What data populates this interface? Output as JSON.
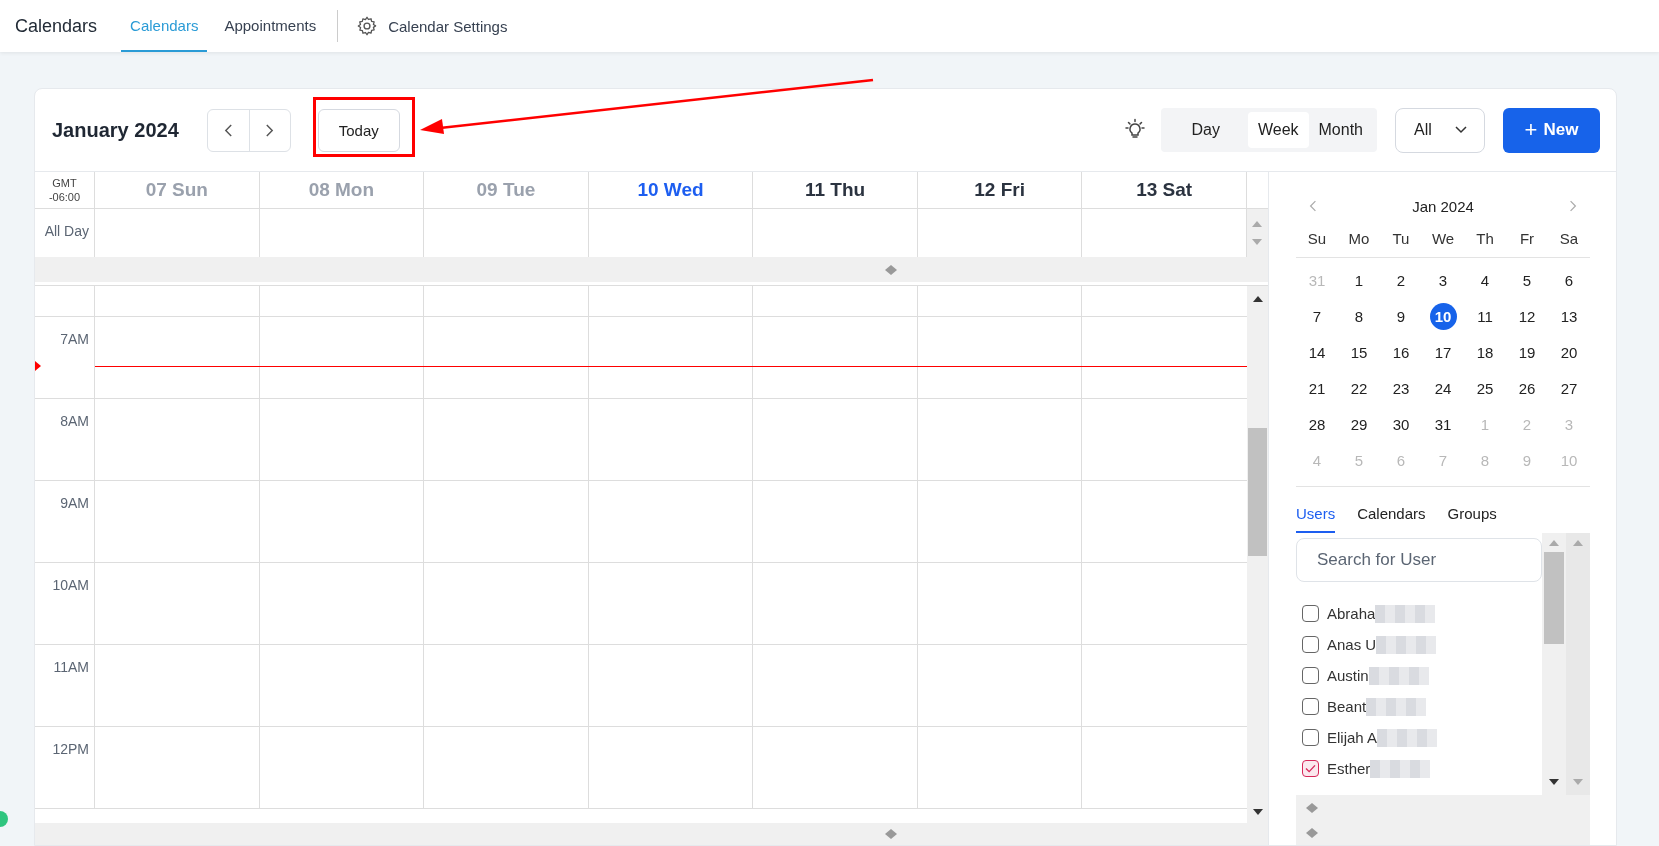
{
  "header": {
    "title": "Calendars",
    "tabs": [
      {
        "label": "Calendars",
        "selected": true
      },
      {
        "label": "Appointments",
        "selected": false
      }
    ],
    "settings": "Calendar Settings"
  },
  "toolbar": {
    "month": "January 2024",
    "today": "Today",
    "views": [
      {
        "label": "Day",
        "selected": false
      },
      {
        "label": "Week",
        "selected": true
      },
      {
        "label": "Month",
        "selected": false
      }
    ],
    "filter": "All",
    "new_button": {
      "icon": "+",
      "label": "New"
    }
  },
  "week": {
    "timezone": [
      "GMT",
      "-06:00"
    ],
    "all_day_label": "All Day",
    "days": [
      {
        "label": "07 Sun",
        "past": true,
        "today": false
      },
      {
        "label": "08 Mon",
        "past": true,
        "today": false
      },
      {
        "label": "09 Tue",
        "past": true,
        "today": false
      },
      {
        "label": "10 Wed",
        "past": false,
        "today": true
      },
      {
        "label": "11 Thu",
        "past": false,
        "today": false
      },
      {
        "label": "12 Fri",
        "past": false,
        "today": false
      },
      {
        "label": "13 Sat",
        "past": false,
        "today": false
      }
    ],
    "hours": [
      "7AM",
      "8AM",
      "9AM",
      "10AM",
      "11AM",
      "12PM"
    ]
  },
  "mini_calendar": {
    "title": "Jan 2024",
    "weekdays": [
      "Su",
      "Mo",
      "Tu",
      "We",
      "Th",
      "Fr",
      "Sa"
    ],
    "weeks": [
      [
        {
          "day": "31",
          "outside": true,
          "selected": false
        },
        {
          "day": "1",
          "outside": false,
          "selected": false
        },
        {
          "day": "2",
          "outside": false,
          "selected": false
        },
        {
          "day": "3",
          "outside": false,
          "selected": false
        },
        {
          "day": "4",
          "outside": false,
          "selected": false
        },
        {
          "day": "5",
          "outside": false,
          "selected": false
        },
        {
          "day": "6",
          "outside": false,
          "selected": false
        }
      ],
      [
        {
          "day": "7",
          "outside": false,
          "selected": false
        },
        {
          "day": "8",
          "outside": false,
          "selected": false
        },
        {
          "day": "9",
          "outside": false,
          "selected": false
        },
        {
          "day": "10",
          "outside": false,
          "selected": true
        },
        {
          "day": "11",
          "outside": false,
          "selected": false
        },
        {
          "day": "12",
          "outside": false,
          "selected": false
        },
        {
          "day": "13",
          "outside": false,
          "selected": false
        }
      ],
      [
        {
          "day": "14",
          "outside": false,
          "selected": false
        },
        {
          "day": "15",
          "outside": false,
          "selected": false
        },
        {
          "day": "16",
          "outside": false,
          "selected": false
        },
        {
          "day": "17",
          "outside": false,
          "selected": false
        },
        {
          "day": "18",
          "outside": false,
          "selected": false
        },
        {
          "day": "19",
          "outside": false,
          "selected": false
        },
        {
          "day": "20",
          "outside": false,
          "selected": false
        }
      ],
      [
        {
          "day": "21",
          "outside": false,
          "selected": false
        },
        {
          "day": "22",
          "outside": false,
          "selected": false
        },
        {
          "day": "23",
          "outside": false,
          "selected": false
        },
        {
          "day": "24",
          "outside": false,
          "selected": false
        },
        {
          "day": "25",
          "outside": false,
          "selected": false
        },
        {
          "day": "26",
          "outside": false,
          "selected": false
        },
        {
          "day": "27",
          "outside": false,
          "selected": false
        }
      ],
      [
        {
          "day": "28",
          "outside": false,
          "selected": false
        },
        {
          "day": "29",
          "outside": false,
          "selected": false
        },
        {
          "day": "30",
          "outside": false,
          "selected": false
        },
        {
          "day": "31",
          "outside": false,
          "selected": false
        },
        {
          "day": "1",
          "outside": true,
          "selected": false
        },
        {
          "day": "2",
          "outside": true,
          "selected": false
        },
        {
          "day": "3",
          "outside": true,
          "selected": false
        }
      ],
      [
        {
          "day": "4",
          "outside": true,
          "selected": false
        },
        {
          "day": "5",
          "outside": true,
          "selected": false
        },
        {
          "day": "6",
          "outside": true,
          "selected": false
        },
        {
          "day": "7",
          "outside": true,
          "selected": false
        },
        {
          "day": "8",
          "outside": true,
          "selected": false
        },
        {
          "day": "9",
          "outside": true,
          "selected": false
        },
        {
          "day": "10",
          "outside": true,
          "selected": false
        }
      ]
    ]
  },
  "people": {
    "tabs": [
      {
        "label": "Users",
        "selected": true
      },
      {
        "label": "Calendars",
        "selected": false
      },
      {
        "label": "Groups",
        "selected": false
      }
    ],
    "search": {
      "placeholder": "Search for User"
    },
    "users": [
      {
        "name": "Abraha",
        "checked": false,
        "redacted": true
      },
      {
        "name": "Anas U",
        "checked": false,
        "redacted": true
      },
      {
        "name": "Austin",
        "checked": false,
        "redacted": true
      },
      {
        "name": "Beant",
        "checked": false,
        "redacted": true
      },
      {
        "name": "Elijah A",
        "checked": false,
        "redacted": true
      },
      {
        "name": "Esther",
        "checked": true,
        "redacted": true
      }
    ]
  }
}
